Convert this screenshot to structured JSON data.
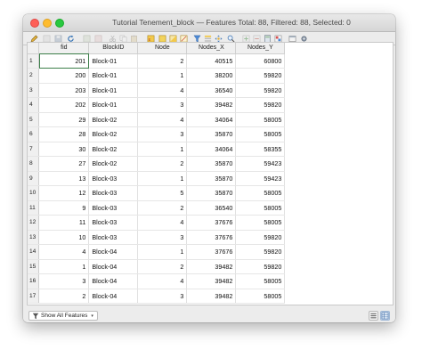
{
  "window": {
    "title": "Tutorial Tenement_block — Features Total: 88, Filtered: 88, Selected: 0"
  },
  "toolbar": {
    "icons": [
      "edit-pencil-icon",
      "multi-edit-icon",
      "save-icon",
      "reload-icon",
      "add-feature-icon",
      "delete-feature-icon",
      "cut-icon",
      "copy-icon",
      "paste-icon",
      "select-expression-icon",
      "select-all-icon",
      "invert-selection-icon",
      "deselect-icon",
      "filter-icon",
      "move-selection-top-icon",
      "pan-map-icon",
      "zoom-map-icon",
      "new-field-icon",
      "delete-field-icon",
      "field-calculator-icon",
      "conditional-format-icon",
      "dock-icon",
      "actions-icon"
    ]
  },
  "table": {
    "columns": [
      "fid",
      "BlockID",
      "Node",
      "Nodes_X",
      "Nodes_Y"
    ],
    "rows": [
      {
        "n": "1",
        "fid": "201",
        "BlockID": "Block-01",
        "Node": "2",
        "Nodes_X": "40515",
        "Nodes_Y": "60800"
      },
      {
        "n": "2",
        "fid": "200",
        "BlockID": "Block-01",
        "Node": "1",
        "Nodes_X": "38200",
        "Nodes_Y": "59820"
      },
      {
        "n": "3",
        "fid": "203",
        "BlockID": "Block-01",
        "Node": "4",
        "Nodes_X": "36540",
        "Nodes_Y": "59820"
      },
      {
        "n": "4",
        "fid": "202",
        "BlockID": "Block-01",
        "Node": "3",
        "Nodes_X": "39482",
        "Nodes_Y": "59820"
      },
      {
        "n": "5",
        "fid": "29",
        "BlockID": "Block-02",
        "Node": "4",
        "Nodes_X": "34064",
        "Nodes_Y": "58005"
      },
      {
        "n": "6",
        "fid": "28",
        "BlockID": "Block-02",
        "Node": "3",
        "Nodes_X": "35870",
        "Nodes_Y": "58005"
      },
      {
        "n": "7",
        "fid": "30",
        "BlockID": "Block-02",
        "Node": "1",
        "Nodes_X": "34064",
        "Nodes_Y": "58355"
      },
      {
        "n": "8",
        "fid": "27",
        "BlockID": "Block-02",
        "Node": "2",
        "Nodes_X": "35870",
        "Nodes_Y": "59423"
      },
      {
        "n": "9",
        "fid": "13",
        "BlockID": "Block-03",
        "Node": "1",
        "Nodes_X": "35870",
        "Nodes_Y": "59423"
      },
      {
        "n": "10",
        "fid": "12",
        "BlockID": "Block-03",
        "Node": "5",
        "Nodes_X": "35870",
        "Nodes_Y": "58005"
      },
      {
        "n": "11",
        "fid": "9",
        "BlockID": "Block-03",
        "Node": "2",
        "Nodes_X": "36540",
        "Nodes_Y": "58005"
      },
      {
        "n": "12",
        "fid": "11",
        "BlockID": "Block-03",
        "Node": "4",
        "Nodes_X": "37676",
        "Nodes_Y": "58005"
      },
      {
        "n": "13",
        "fid": "10",
        "BlockID": "Block-03",
        "Node": "3",
        "Nodes_X": "37676",
        "Nodes_Y": "59820"
      },
      {
        "n": "14",
        "fid": "4",
        "BlockID": "Block-04",
        "Node": "1",
        "Nodes_X": "37676",
        "Nodes_Y": "59820"
      },
      {
        "n": "15",
        "fid": "1",
        "BlockID": "Block-04",
        "Node": "2",
        "Nodes_X": "39482",
        "Nodes_Y": "59820"
      },
      {
        "n": "16",
        "fid": "3",
        "BlockID": "Block-04",
        "Node": "4",
        "Nodes_X": "39482",
        "Nodes_Y": "58005"
      },
      {
        "n": "17",
        "fid": "2",
        "BlockID": "Block-04",
        "Node": "3",
        "Nodes_X": "39482",
        "Nodes_Y": "58005"
      }
    ]
  },
  "statusbar": {
    "filter_label": "Show All Features"
  },
  "colors": {
    "close": "#fe5f57",
    "minimize": "#febc2e",
    "maximize": "#28c840",
    "current_cell_outline": "#3d7f4a"
  }
}
